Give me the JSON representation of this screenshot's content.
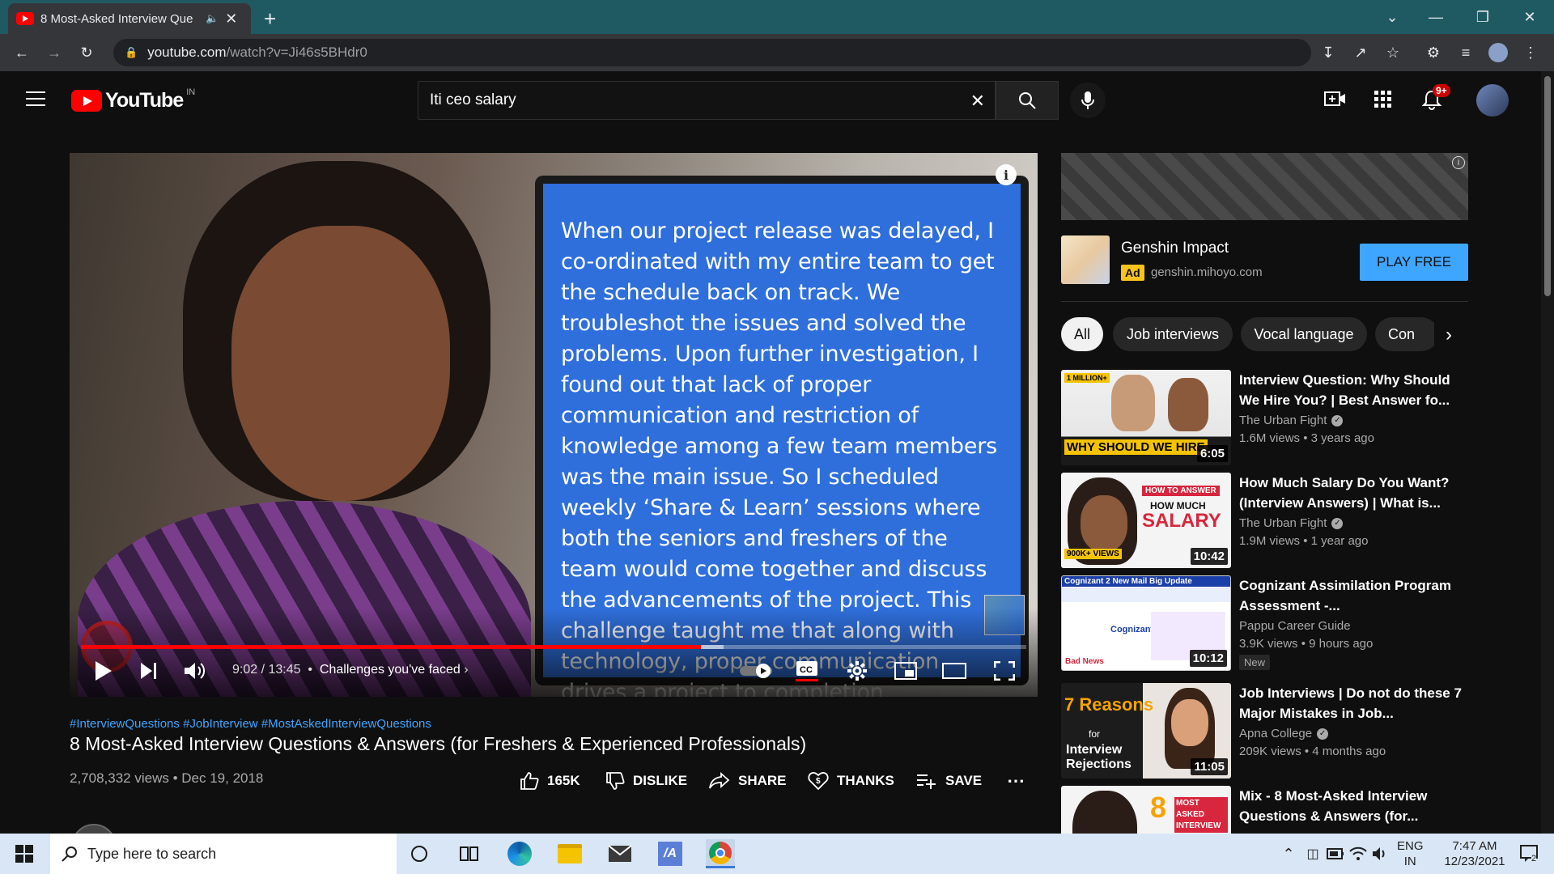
{
  "browser": {
    "tab_title": "8 Most-Asked Interview Que",
    "url_main": "youtube.com",
    "url_path": "/watch?v=Ji46s5BHdr0"
  },
  "youtube": {
    "logo_text": "YouTube",
    "region": "IN",
    "search_query": "Iti ceo salary",
    "notification_count": "9+"
  },
  "player": {
    "slide_text": "When our project release was delayed, I co-ordinated with my entire team to get the schedule back on track. We troubleshot the issues and solved the problems. Upon further investigation, I found out that lack of proper communication and restriction of knowledge among a few team members was the main issue. So I scheduled weekly ‘Share & Learn’ sessions where both the seniors and freshers of the team would come together and discuss the advancements of the project. This challenge taught me that along with technology, proper communication drives a project to completion.",
    "time": "9:02 / 13:45",
    "chapter": "Challenges you've faced",
    "progress": 0.656,
    "buffered": 0.68
  },
  "video": {
    "hashtags": "#InterviewQuestions #JobInterview #MostAskedInterviewQuestions",
    "title": "8 Most-Asked Interview Questions & Answers (for Freshers & Experienced Professionals)",
    "views_date": "2,708,332 views • Dec 19, 2018",
    "actions": {
      "like": "165K",
      "dislike": "DISLIKE",
      "share": "SHARE",
      "thanks": "THANKS",
      "save": "SAVE"
    }
  },
  "ad": {
    "title": "Genshin Impact",
    "badge": "Ad",
    "domain": "genshin.mihoyo.com",
    "cta": "PLAY FREE"
  },
  "chips": [
    "All",
    "Job interviews",
    "Vocal language",
    "Con"
  ],
  "recommendations": [
    {
      "title": "Interview Question: Why Should We Hire You? | Best Answer fo...",
      "channel": "The Urban Fight",
      "meta": "1.6M views • 3 years ago",
      "duration": "6:05",
      "thumb_caption": "WHY SHOULD WE HIRE"
    },
    {
      "title": "How Much Salary Do You Want? (Interview Answers) | What is...",
      "channel": "The Urban Fight",
      "meta": "1.9M views • 1 year ago",
      "duration": "10:42",
      "thumb_caption": "SALARY"
    },
    {
      "title": "Cognizant Assimilation Program Assessment -...",
      "channel": "Pappu Career Guide",
      "meta": "3.9K views • 9 hours ago",
      "duration": "10:12",
      "badge": "New",
      "thumb_caption": "Cognizant 2 New Mail Big Update"
    },
    {
      "title": "Job Interviews | Do not do these 7 Major Mistakes in Job...",
      "channel": "Apna College",
      "meta": "209K views • 4 months ago",
      "duration": "11:05",
      "thumb_caption": "7 Reasons"
    },
    {
      "title": "Mix - 8 Most-Asked Interview Questions & Answers (for...",
      "thumb_caption": "MOST ASKED INTERVIEW"
    }
  ],
  "taskbar": {
    "search_placeholder": "Type here to search",
    "lang": "ENG",
    "region": "IN",
    "time": "7:47 AM",
    "date": "12/23/2021",
    "notif": "2"
  }
}
